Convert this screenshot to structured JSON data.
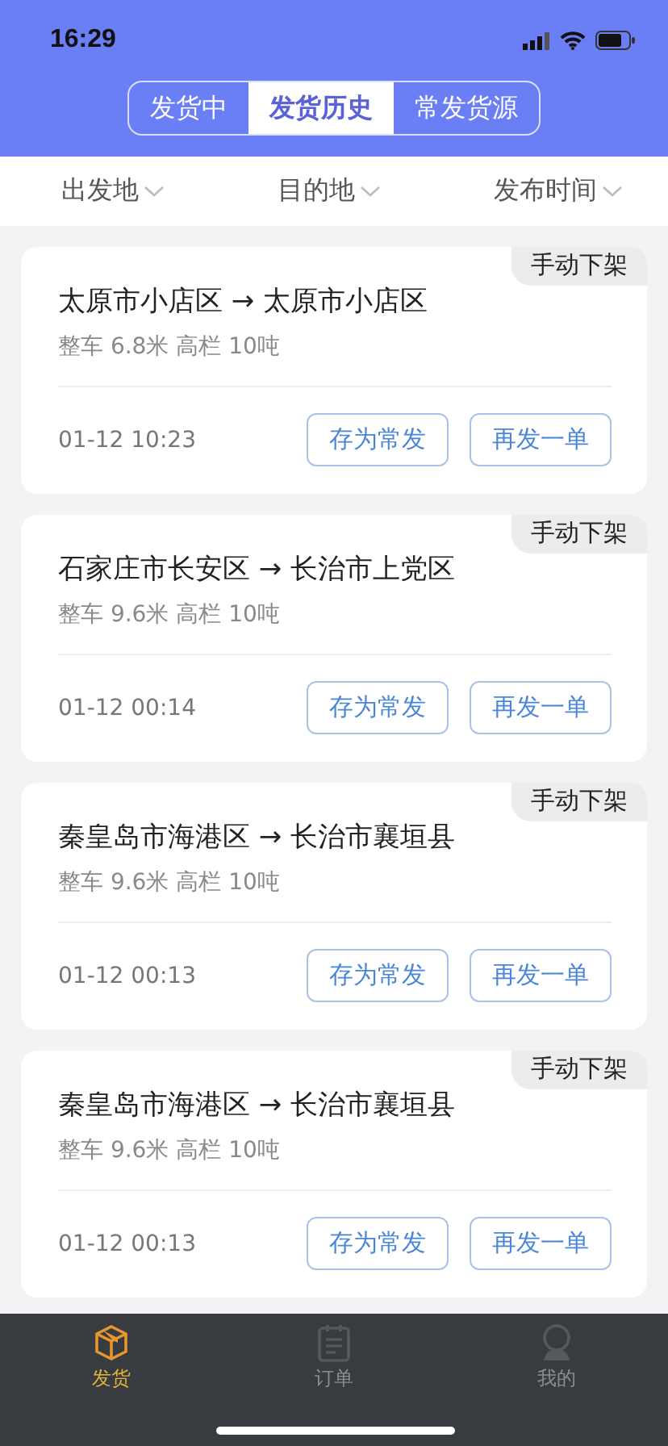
{
  "status_bar": {
    "time": "16:29"
  },
  "segments": [
    {
      "label": "发货中",
      "selected": false
    },
    {
      "label": "发货历史",
      "selected": true
    },
    {
      "label": "常发货源",
      "selected": false
    }
  ],
  "filters": [
    {
      "label": "出发地"
    },
    {
      "label": "目的地"
    },
    {
      "label": "发布时间"
    }
  ],
  "shipments": [
    {
      "badge": "手动下架",
      "route": "太原市小店区 → 太原市小店区",
      "spec": "整车 6.8米 高栏 10吨",
      "time": "01-12 10:23",
      "actions": [
        "存为常发",
        "再发一单"
      ]
    },
    {
      "badge": "手动下架",
      "route": "石家庄市长安区 → 长治市上党区",
      "spec": "整车 9.6米 高栏 10吨",
      "time": "01-12 00:14",
      "actions": [
        "存为常发",
        "再发一单"
      ]
    },
    {
      "badge": "手动下架",
      "route": "秦皇岛市海港区 → 长治市襄垣县",
      "spec": "整车 9.6米 高栏 10吨",
      "time": "01-12 00:13",
      "actions": [
        "存为常发",
        "再发一单"
      ]
    },
    {
      "badge": "手动下架",
      "route": "秦皇岛市海港区 → 长治市襄垣县",
      "spec": "整车 9.6米 高栏 10吨",
      "time": "01-12 00:13",
      "actions": [
        "存为常发",
        "再发一单"
      ]
    }
  ],
  "tab_bar": [
    {
      "label": "发货",
      "kind": "box",
      "selected": true
    },
    {
      "label": "订单",
      "kind": "clipboard",
      "selected": false
    },
    {
      "label": "我的",
      "kind": "person",
      "selected": false
    }
  ]
}
